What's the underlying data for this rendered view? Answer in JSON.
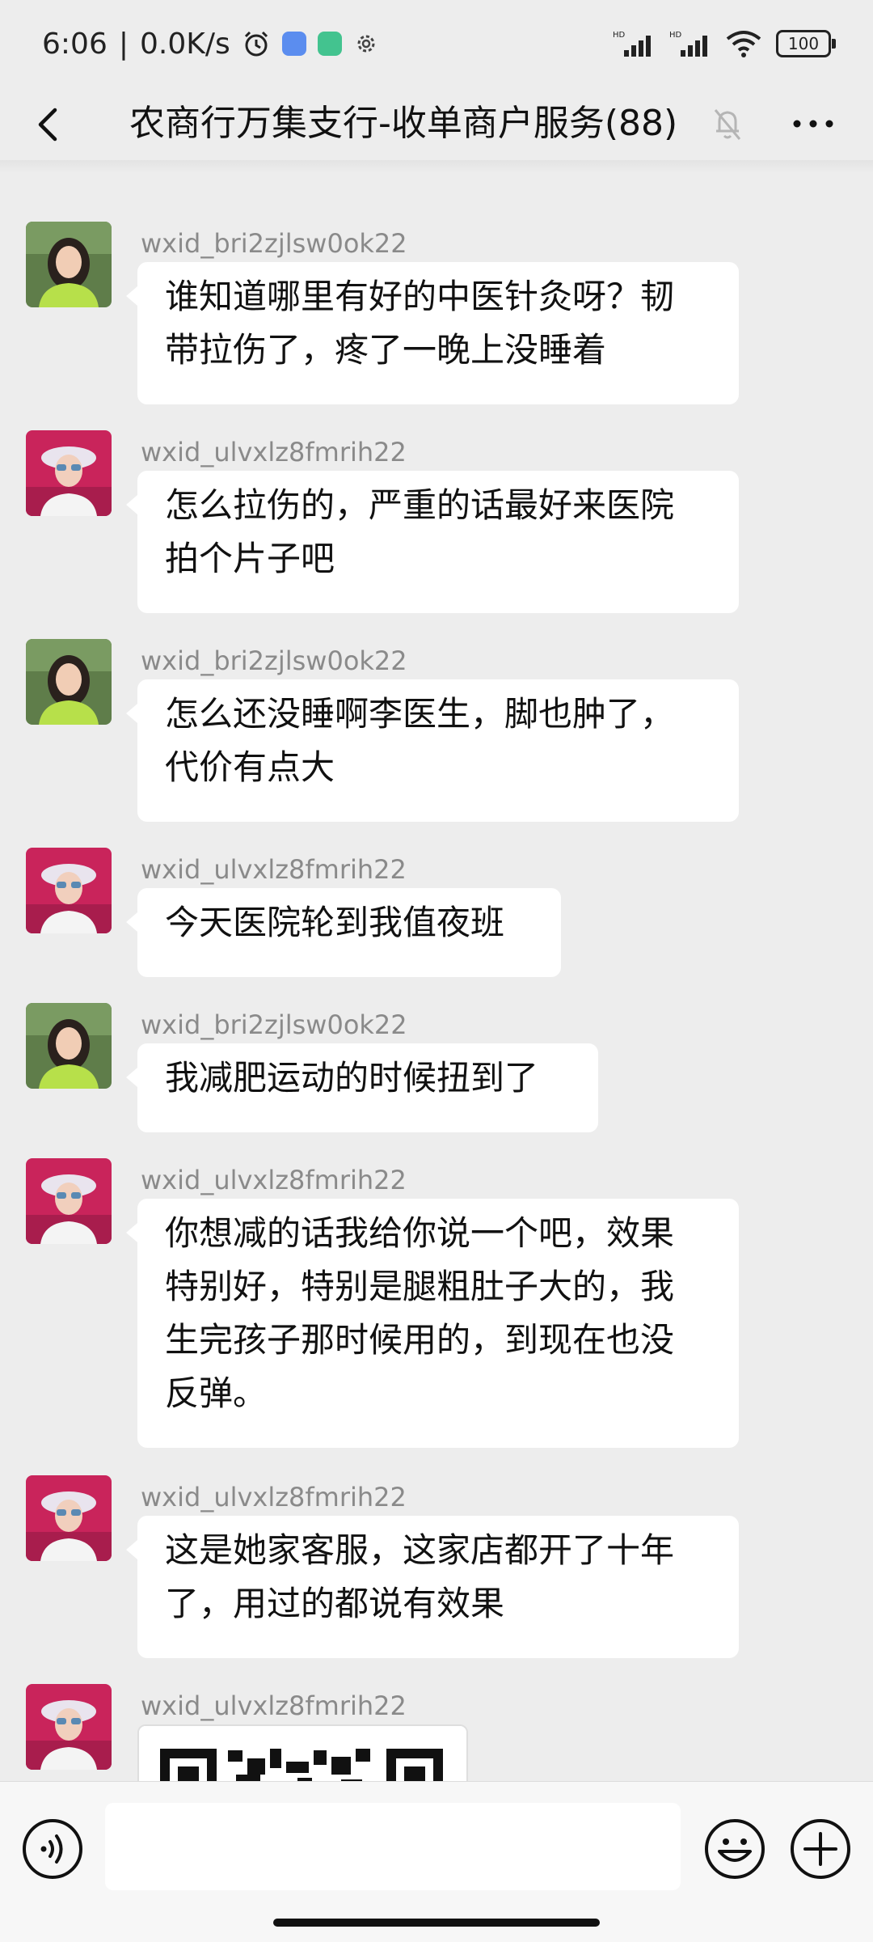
{
  "status_bar": {
    "time": "6:06",
    "network_speed": "0.0K/s",
    "separator": "|",
    "signal_badge_1": "HD",
    "signal_badge_2": "HD",
    "battery": "100"
  },
  "header": {
    "title": "农商行万集支行-收单商户服务(88)"
  },
  "messages": [
    {
      "sender": "wxid_bri2zjlsw0ok22",
      "lines": [
        "谁知道哪里有好的中医针灸呀？韧",
        "带拉伤了，疼了一晚上没睡着"
      ]
    },
    {
      "sender": "wxid_ulvxlz8fmrih22",
      "lines": [
        "怎么拉伤的，严重的话最好来医院",
        "拍个片子吧"
      ]
    },
    {
      "sender": "wxid_bri2zjlsw0ok22",
      "lines": [
        "怎么还没睡啊李医生，脚也肿了，",
        "代价有点大"
      ]
    },
    {
      "sender": "wxid_ulvxlz8fmrih22",
      "lines": [
        "今天医院轮到我值夜班"
      ]
    },
    {
      "sender": "wxid_bri2zjlsw0ok22",
      "lines": [
        "我减肥运动的时候扭到了"
      ]
    },
    {
      "sender": "wxid_ulvxlz8fmrih22",
      "lines": [
        "你想减的话我给你说一个吧，效果",
        "特别好，特别是腿粗肚子大的，我",
        "生完孩子那时候用的，到现在也没",
        "反弹。"
      ]
    },
    {
      "sender": "wxid_ulvxlz8fmrih22",
      "lines": [
        "这是她家客服，这家店都开了十年",
        "了，用过的都说有效果"
      ]
    },
    {
      "sender": "wxid_ulvxlz8fmrih22",
      "lines": []
    }
  ],
  "colors": {
    "background": "#ededed",
    "bubble": "#ffffff",
    "sender_text": "#8a8a8a"
  },
  "icons": [
    "back-arrow-icon",
    "mute-bell-icon",
    "more-icon",
    "voice-icon",
    "emoji-icon",
    "add-icon",
    "alarm-icon",
    "wifi-icon",
    "signal-icon",
    "settings-icon"
  ]
}
